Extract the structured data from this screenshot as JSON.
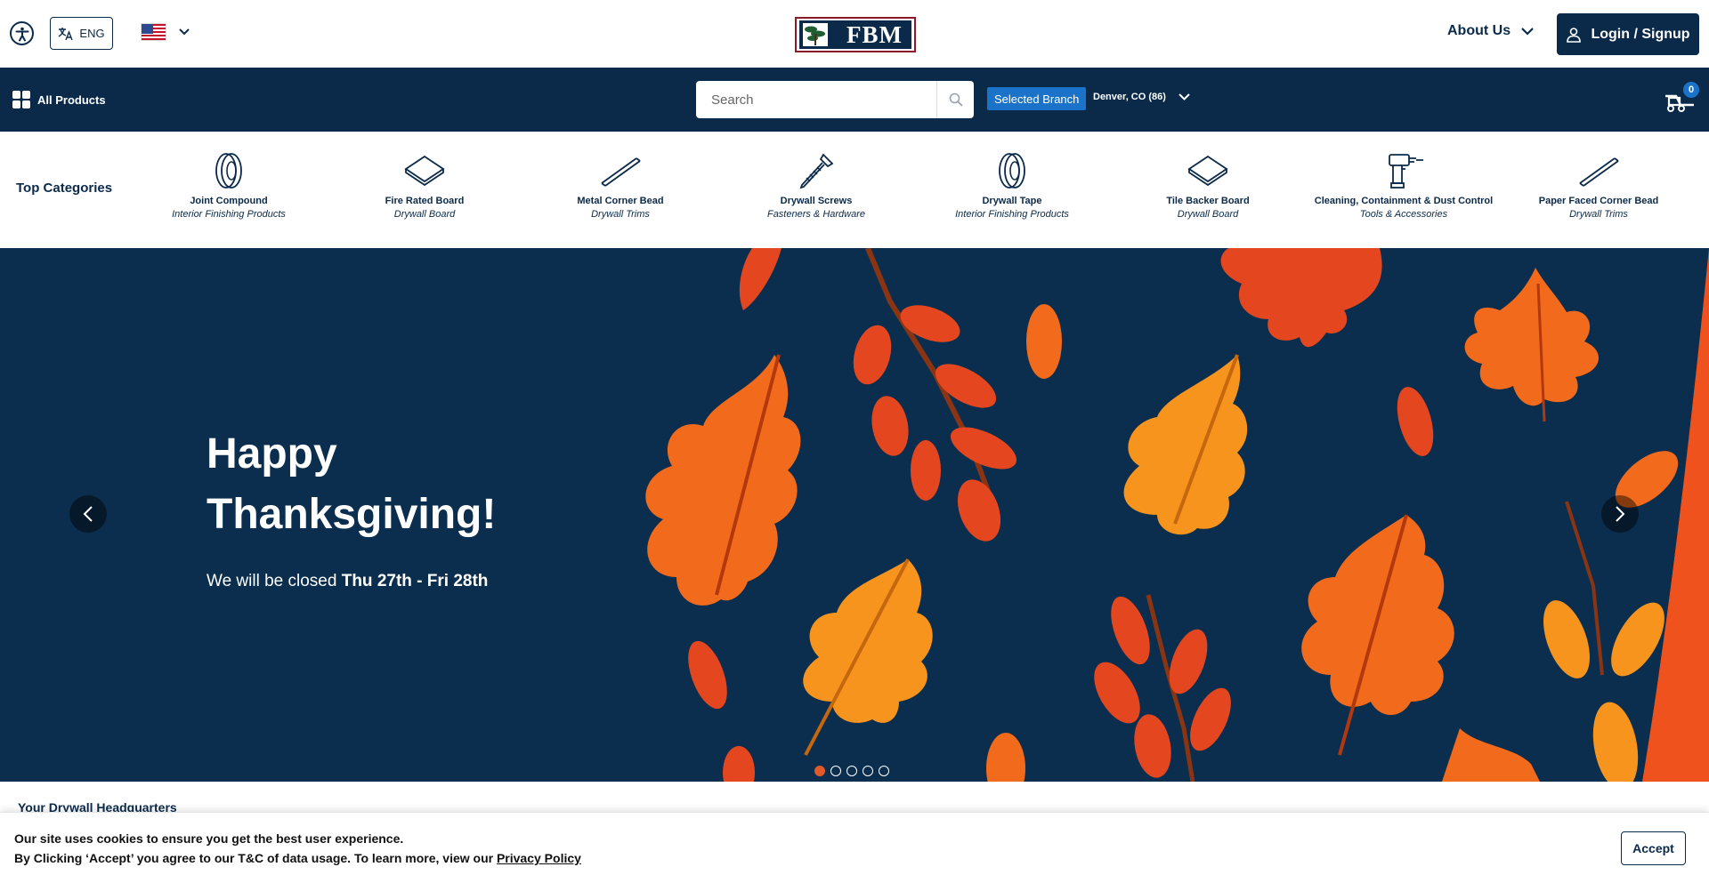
{
  "header": {
    "language_label": "ENG",
    "logo_text": "FBM",
    "about_label": "About Us",
    "login_label": "Login / Signup"
  },
  "nav": {
    "all_products_label": "All Products",
    "search_placeholder": "Search",
    "selected_branch_label": "Selected Branch",
    "branch_name": "Denver, CO (86)",
    "cart_count": "0"
  },
  "categories": {
    "title": "Top Categories",
    "items": [
      {
        "name": "Joint Compound",
        "sub": "Interior Finishing Products",
        "icon": "tape-roll-icon"
      },
      {
        "name": "Fire Rated Board",
        "sub": "Drywall Board",
        "icon": "board-icon"
      },
      {
        "name": "Metal Corner Bead",
        "sub": "Drywall Trims",
        "icon": "corner-bead-icon"
      },
      {
        "name": "Drywall Screws",
        "sub": "Fasteners & Hardware",
        "icon": "screw-icon"
      },
      {
        "name": "Drywall Tape",
        "sub": "Interior Finishing Products",
        "icon": "tape-roll-icon"
      },
      {
        "name": "Tile Backer Board",
        "sub": "Drywall Board",
        "icon": "board-icon"
      },
      {
        "name": "Cleaning, Containment & Dust Control",
        "sub": "Tools & Accessories",
        "icon": "drill-icon"
      },
      {
        "name": "Paper Faced Corner Bead",
        "sub": "Drywall Trims",
        "icon": "corner-bead-icon"
      }
    ]
  },
  "hero": {
    "title": "Happy Thanksgiving!",
    "sub_prefix": "We will be closed ",
    "sub_bold": "Thu 27th - Fri 28th",
    "slide_count": 5,
    "active_slide": 1,
    "colors": {
      "background": "#0b2e4e",
      "leaf_orange": "#f26a1b",
      "leaf_red": "#e4471f",
      "leaf_amber": "#f7941d"
    }
  },
  "section": {
    "heading": "Your Drywall Headquarters"
  },
  "cookie": {
    "line1": "Our site uses cookies to ensure you get the best user experience.",
    "line2_prefix": "By Clicking ‘Accept’ you agree to our T&C of data usage. To learn more, view our ",
    "privacy_link": "Privacy Policy",
    "accept_label": "Accept"
  },
  "colors": {
    "brand_navy": "#0b2a4a",
    "branch_blue": "#1a73c9"
  }
}
